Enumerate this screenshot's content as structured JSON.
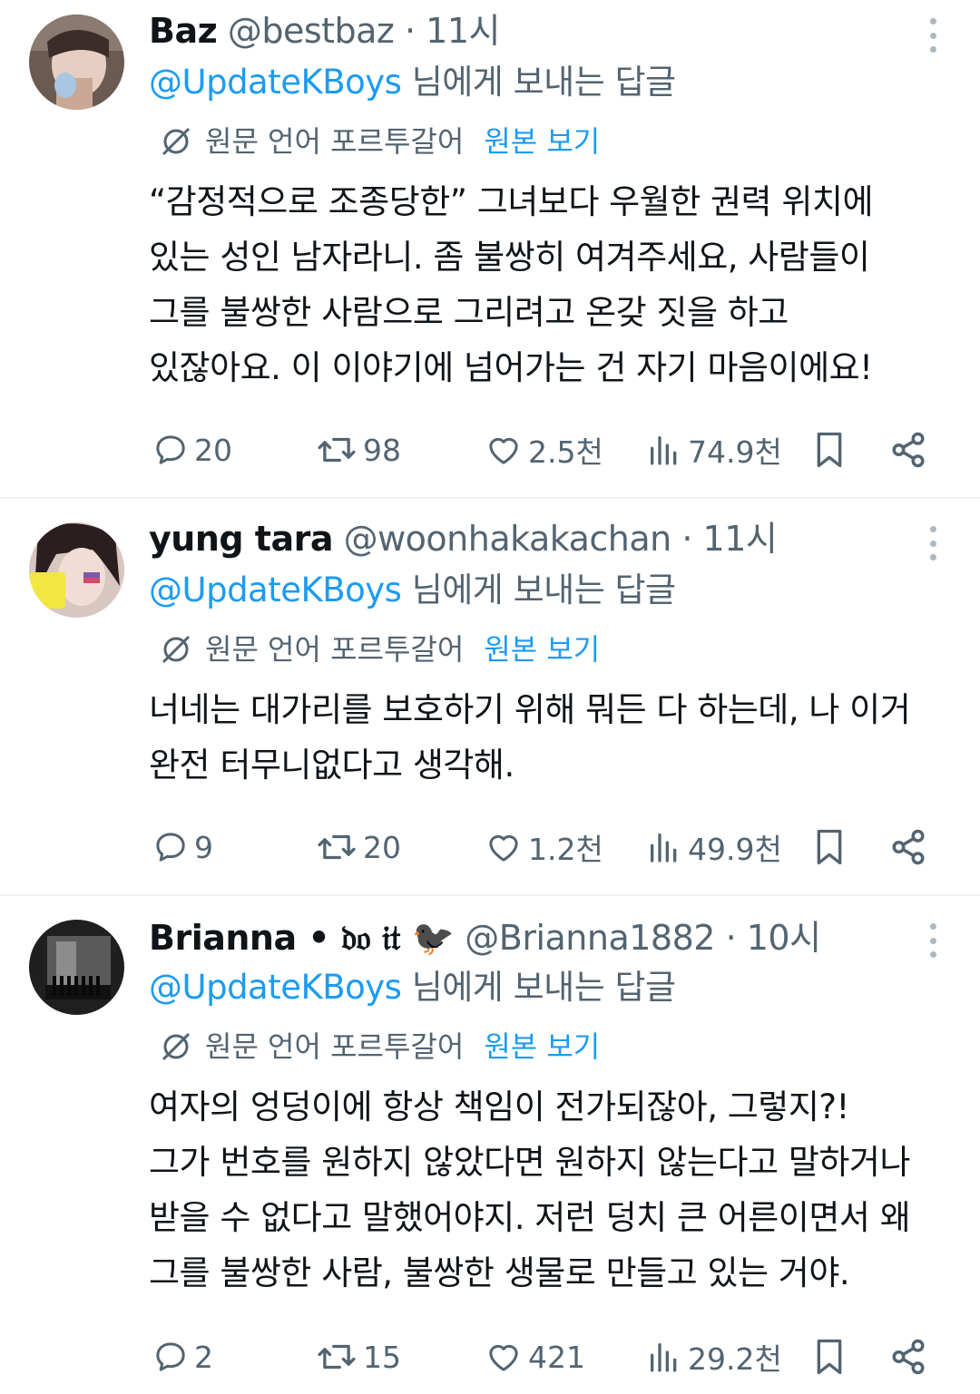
{
  "tweets": [
    {
      "name": "Baz",
      "handle": "@bestbaz",
      "dot": "·",
      "time": "11시",
      "reply_to_handle": "@UpdateKBoys",
      "reply_suffix": " 님에게 보내는 답글",
      "translation_note": "원문 언어 포르투갈어",
      "show_original": "원본 보기",
      "body": [
        "“감정적으로 조종당한” 그녀보다 우월한 권력 위치에",
        "있는 성인 남자라니. 좀 불쌍히 여겨주세요, 사람들이",
        "그를 불쌍한 사람으로 그리려고 온갖 짓을 하고",
        "있잖아요. 이 이야기에 넘어가는 건 자기 마음이에요!"
      ],
      "replies": "20",
      "retweets": "98",
      "likes": "2.5천",
      "views": "74.9천"
    },
    {
      "name": "yung tara",
      "handle": "@woonhakakachan",
      "dot": "·",
      "time": "11시",
      "reply_to_handle": "@UpdateKBoys",
      "reply_suffix": " 님에게 보내는 답글",
      "translation_note": "원문 언어 포르투갈어",
      "show_original": "원본 보기",
      "body": [
        "너네는 대가리를 보호하기 위해 뭐든 다 하는데, 나 이거",
        "완전 터무니없다고 생각해."
      ],
      "replies": "9",
      "retweets": "20",
      "likes": "1.2천",
      "views": "49.9천"
    },
    {
      "name": "Brianna • 𝔡𝔬 𝔦𝔱 🐦‍⬛",
      "handle": "@Brianna1882",
      "dot": "·",
      "time": "10시",
      "reply_to_handle": "@UpdateKBoys",
      "reply_suffix": " 님에게 보내는 답글",
      "translation_note": "원문 언어 포르투갈어",
      "show_original": "원본 보기",
      "body": [
        "여자의 엉덩이에 항상 책임이 전가되잖아, 그렇지?!",
        "그가 번호를 원하지 않았다면 원하지 않는다고 말하거나",
        "받을 수 없다고 말했어야지. 저런 덩치 큰 어른이면서 왜",
        "그를 불쌍한 사람, 불쌍한 생물로 만들고 있는 거야."
      ],
      "replies": "2",
      "retweets": "15",
      "likes": "421",
      "views": "29.2천"
    }
  ],
  "icons": {
    "reply": "speech-bubble-icon",
    "retweet": "retweet-icon",
    "like": "heart-icon",
    "views": "bar-chart-icon",
    "bookmark": "bookmark-icon",
    "share": "share-icon",
    "more": "vertical-dots-icon",
    "translate": "translate-off-icon"
  },
  "colors": {
    "link": "#1d9bf0",
    "secondary": "#536471",
    "text": "#0f1419",
    "divider": "#eff3f4"
  }
}
